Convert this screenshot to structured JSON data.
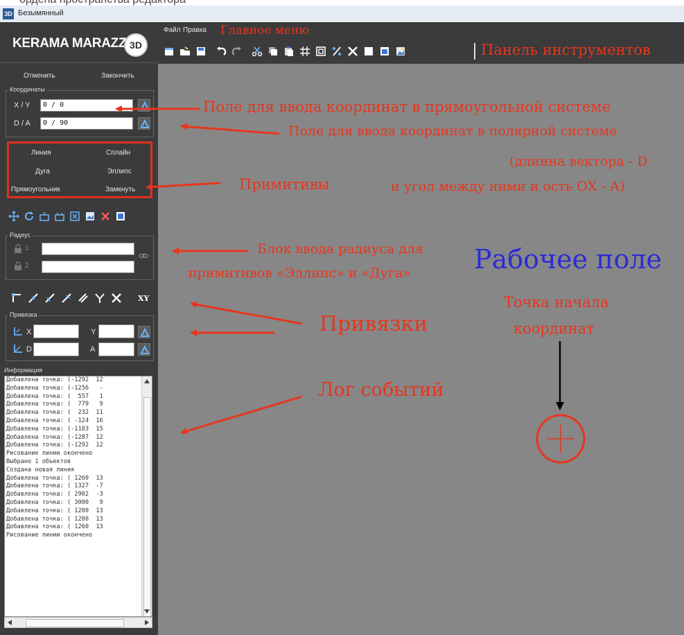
{
  "top_crop_text": "ордена пространства редактора",
  "window": {
    "icon": "3D",
    "title": "Безымянный"
  },
  "logo": {
    "text": "KERAMA MARAZZI",
    "badge": "3D"
  },
  "actions": {
    "undo_label": "Отменить",
    "finish_label": "Закончить"
  },
  "coords": {
    "legend": "Координаты",
    "xy_label": "X / Y",
    "xy_value": "0 / 0",
    "da_label": "D / A",
    "da_value": "0 / 90"
  },
  "primitives": {
    "line": "Линия",
    "spline": "Сплайн",
    "arc": "Дуга",
    "ellipse": "Эллипс",
    "rect": "Прямоугольник",
    "close": "Замкнуть"
  },
  "radius": {
    "legend": "Радиус",
    "r1": "1",
    "r2": "2"
  },
  "snaps": {
    "xy_text": "XY",
    "legend": "Привязка",
    "x_label": "X",
    "y_label": "Y",
    "d_label": "D",
    "a_label": "A"
  },
  "info": {
    "label": "Информация",
    "log": [
      "Добавлена точка: (-1292  12",
      "Добавлена точка: (-1256   -",
      "Добавлена точка: (  557   1",
      "Добавлена точка: (  779   9",
      "Добавлена точка: (  232  11",
      "Добавлена точка: ( -124  16",
      "Добавлена точка: (-1183  15",
      "Добавлена точка: (-1287  12",
      "Добавлена точка: (-1292  12",
      "Рисование линии окончено",
      "Выбрано 1 объектов",
      "Создана новая линия",
      "Добавлена точка: ( 1260  13",
      "Добавлена точка: ( 1327  -7",
      "Добавлена точка: ( 2902  -3",
      "Добавлена точка: ( 3000   9",
      "Добавлена точка: ( 1280  13",
      "Добавлена точка: ( 1280  13",
      "Добавлена точка: ( 1260  13",
      "Рисование линии окончено"
    ]
  },
  "menu": {
    "file": "Файл",
    "edit": "Правка"
  },
  "annotations": {
    "main_menu": "Главное меню",
    "toolbar": "Панель инструментов",
    "rect_field": "Поле для ввода координат в прямоугольной системе",
    "polar_field": "Поле для ввода координат в полярной системе",
    "polar_note_1": "(длинна вектора - D",
    "polar_note_2": "и угол между ними и ость ОХ - А)",
    "primitives": "Примитивы",
    "radius_1": "Блок ввода радиуса для",
    "radius_2": "примитивов «Эллипс» и «Дуга»",
    "work_area": "Рабочее поле",
    "origin_1": "Точка начала",
    "origin_2": "координат",
    "snaps": "Привязки",
    "log": "Лог событий"
  },
  "colors": {
    "panel": "#3b3b3b",
    "work": "#878787",
    "annotation_red": "#e8351e",
    "annotation_blue": "#2b2bd6"
  }
}
